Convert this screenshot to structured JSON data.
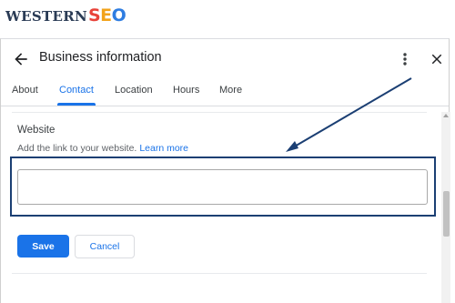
{
  "logo": {
    "main": "WESTERN",
    "seo": [
      "S",
      "E",
      "O"
    ]
  },
  "header": {
    "title": "Business information"
  },
  "tabs": [
    {
      "label": "About",
      "active": false
    },
    {
      "label": "Contact",
      "active": true
    },
    {
      "label": "Location",
      "active": false
    },
    {
      "label": "Hours",
      "active": false
    },
    {
      "label": "More",
      "active": false
    }
  ],
  "website": {
    "label": "Website",
    "help_text": "Add the link to your website.",
    "learn_more": "Learn more",
    "value": "",
    "placeholder": ""
  },
  "actions": {
    "save_label": "Save",
    "cancel_label": "Cancel"
  },
  "icons": {
    "back": "arrow-left-icon",
    "menu": "more-vert-icon",
    "close": "close-icon"
  },
  "colors": {
    "accent": "#1a73e8",
    "annotation": "#1b3f73"
  }
}
